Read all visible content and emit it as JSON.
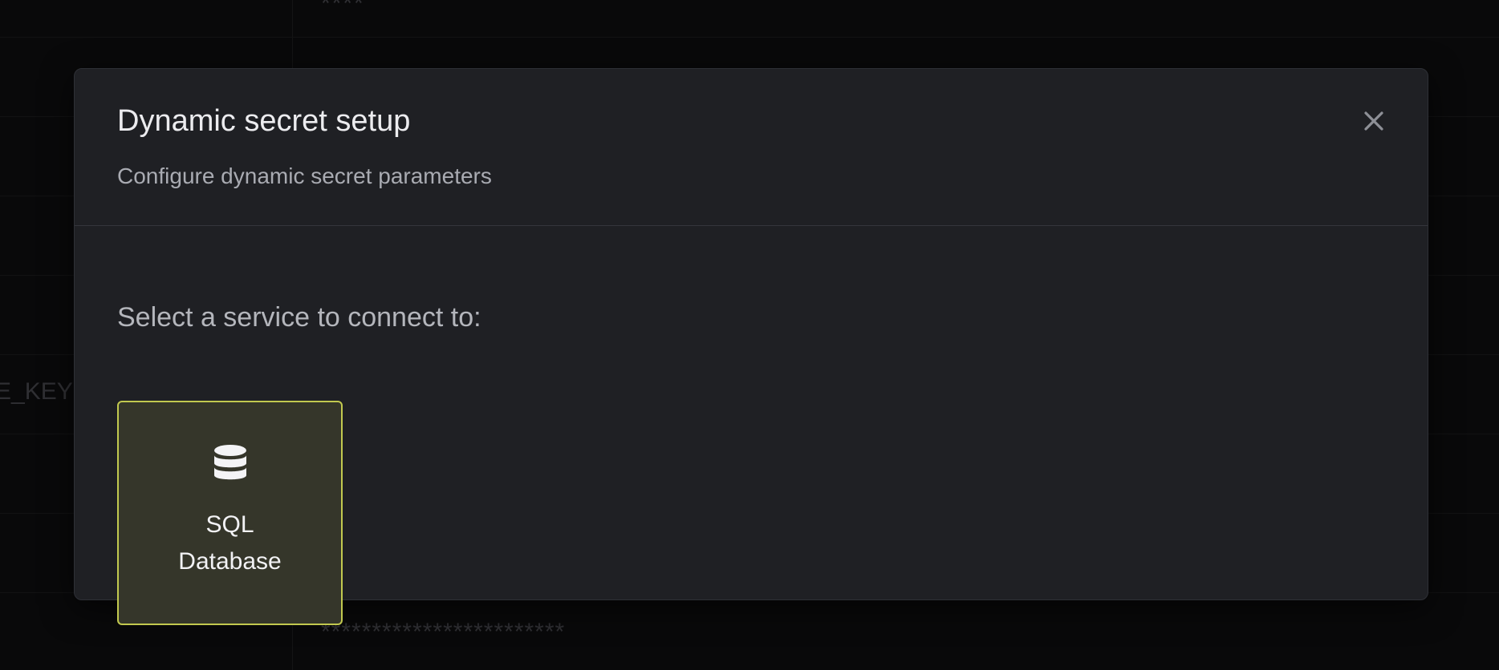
{
  "background": {
    "masked_value_top": "****",
    "masked_value_bottom": "************************",
    "partial_key_name": "E_KEY",
    "partial_comma": ","
  },
  "modal": {
    "title": "Dynamic secret setup",
    "subtitle": "Configure dynamic secret parameters",
    "close_icon": "close-icon",
    "prompt": "Select a service to connect to:",
    "services": [
      {
        "label_line1": "SQL",
        "label_line2": "Database",
        "icon": "database-icon",
        "selected": true
      }
    ]
  },
  "colors": {
    "modal_background": "#1f2024",
    "selected_card_background": "#35362a",
    "selected_card_border": "#c2c94f"
  }
}
